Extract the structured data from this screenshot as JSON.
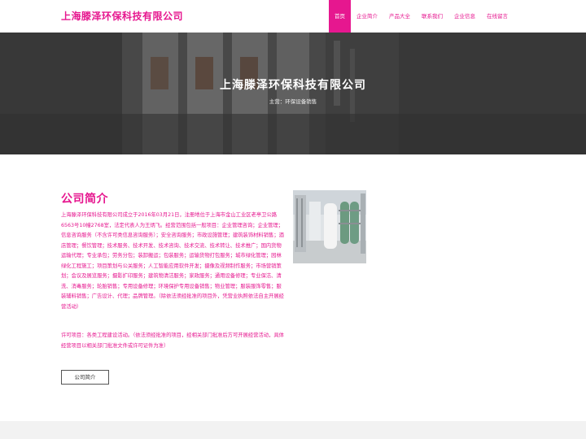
{
  "header": {
    "brand": "上海滕泽环保科技有限公司",
    "nav": [
      {
        "label": "首页",
        "active": true
      },
      {
        "label": "企业简介",
        "active": false
      },
      {
        "label": "产品大全",
        "active": false
      },
      {
        "label": "联系我们",
        "active": false
      },
      {
        "label": "企业信息",
        "active": false
      },
      {
        "label": "在线留言",
        "active": false
      }
    ]
  },
  "hero": {
    "title": "上海滕泽环保科技有限公司",
    "subtitle": "主营：环保设备销售"
  },
  "about": {
    "title": "公司简介",
    "intro": "上海滕泽环保科技有限公司成立于2016年03月21日，注册地位于上海市金山工业区老亭卫公路6563号10幢2768室，法定代表人为王炳飞。经营范围包括一般项目：企业管理咨询；企业管理；信息咨询服务（不含许可类信息咨询服务）；安全咨询服务；市政设施管理；建筑装饰材料销售；酒店管理；餐饮管理；技术服务、技术开发、技术咨询、技术交流、技术转让、技术推广；国内货物运输代理；专业承包；劳务分包；装卸搬运；包装服务；运输货物打包服务；城市绿化管理；园林绿化工程施工；项目策划与公关服务；人工智能应用软件开发；摄像及视频制作服务；市场营销策划；会议及展览服务；摄影扩印服务；建筑物清洁服务；家政服务；通用设备修理；专业保洁、清洗、消毒服务；轮胎销售；专用设备修理；环境保护专用设备销售；物业管理；服装服饰零售；服装辅料销售；广告设计、代理；品牌管理。（除依法须经批准的项目外，凭营业执照依法自主开展经营活动）",
    "license": "许可项目：各类工程建设活动。（依法须经批准的项目，经相关部门批准后方可开展经营活动，具体经营项目以相关部门批准文件或许可证件为准）",
    "button": "公司简介"
  },
  "colors": {
    "accent": "#e6178f",
    "hero_overlay": "#3a3a3a",
    "footer": "#f2f2f2"
  }
}
